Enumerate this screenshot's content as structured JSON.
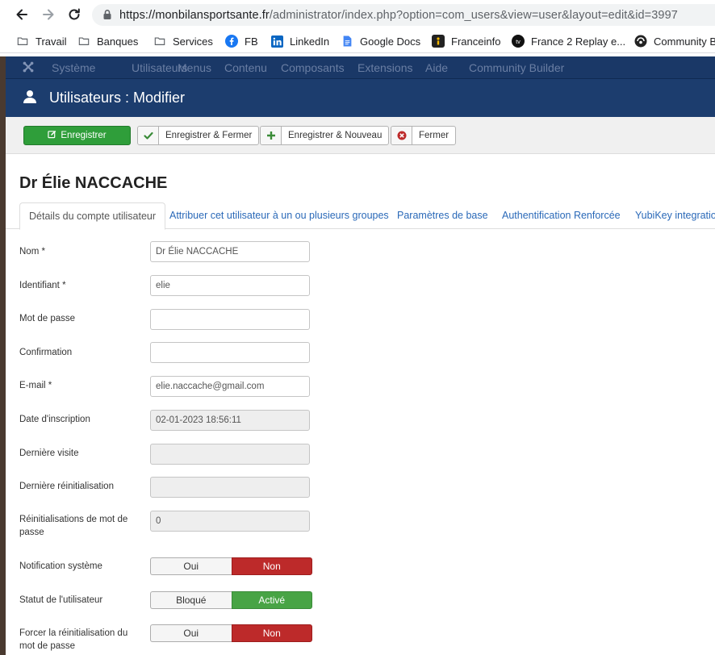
{
  "browser": {
    "url_domain": "https://monbilansportsante.fr",
    "url_path": "/administrator/index.php?option=com_users&view=user&layout=edit&id=3997",
    "bookmarks": [
      {
        "label": "Travail",
        "icon": "folder-icon"
      },
      {
        "label": "Banques",
        "icon": "folder-icon"
      },
      {
        "label": "Services",
        "icon": "folder-icon"
      },
      {
        "label": "FB",
        "icon": "facebook-icon"
      },
      {
        "label": "LinkedIn",
        "icon": "linkedin-icon"
      },
      {
        "label": "Google Docs",
        "icon": "google-docs-icon"
      },
      {
        "label": "Franceinfo",
        "icon": "franceinfo-icon"
      },
      {
        "label": "France 2 Replay e...",
        "icon": "france-tv-icon"
      },
      {
        "label": "Community B",
        "icon": "community-icon"
      }
    ]
  },
  "topmenu": {
    "items": [
      "Système",
      "Utilisateurs",
      "Menus",
      "Contenu",
      "Composants",
      "Extensions",
      "Aide",
      "Community Builder"
    ]
  },
  "header": {
    "title": "Utilisateurs : Modifier"
  },
  "toolbar": {
    "save": "Enregistrer",
    "save_close": "Enregistrer & Fermer",
    "save_new": "Enregistrer & Nouveau",
    "close": "Fermer"
  },
  "user_heading": "Dr Élie NACCACHE",
  "tabs": [
    "Détails du compte utilisateur",
    "Attribuer cet utilisateur à un ou plusieurs groupes",
    "Paramètres de base",
    "Authentification Renforcée",
    "YubiKey integration"
  ],
  "form": {
    "name": {
      "label": "Nom *",
      "value": "Dr Élie NACCACHE"
    },
    "username": {
      "label": "Identifiant *",
      "value": "elie"
    },
    "password": {
      "label": "Mot de passe",
      "value": ""
    },
    "confirm": {
      "label": "Confirmation",
      "value": ""
    },
    "email": {
      "label": "E-mail *",
      "value": "elie.naccache@gmail.com"
    },
    "register_date": {
      "label": "Date d'inscription",
      "value": "02-01-2023 18:56:11"
    },
    "last_visit": {
      "label": "Dernière visite",
      "value": ""
    },
    "last_reset": {
      "label": "Dernière réinitialisation",
      "value": ""
    },
    "reset_count": {
      "label": "Réinitialisations de mot de passe",
      "value": "0"
    },
    "send_email": {
      "label": "Notification système",
      "options": [
        "Oui",
        "Non"
      ],
      "selected": "Non"
    },
    "status": {
      "label": "Statut de l'utilisateur",
      "options": [
        "Bloqué",
        "Activé"
      ],
      "selected": "Activé"
    },
    "require_reset": {
      "label": "Forcer la réinitialisation du mot de passe",
      "options": [
        "Oui",
        "Non"
      ],
      "selected": "Non"
    }
  },
  "colors": {
    "navbar": "#1a3867",
    "titlebar": "#1c3d6e",
    "save_button": "#2f9e3a",
    "toggle_off": "#bd2a2a",
    "toggle_on": "#48a445",
    "link": "#2a69b8"
  }
}
